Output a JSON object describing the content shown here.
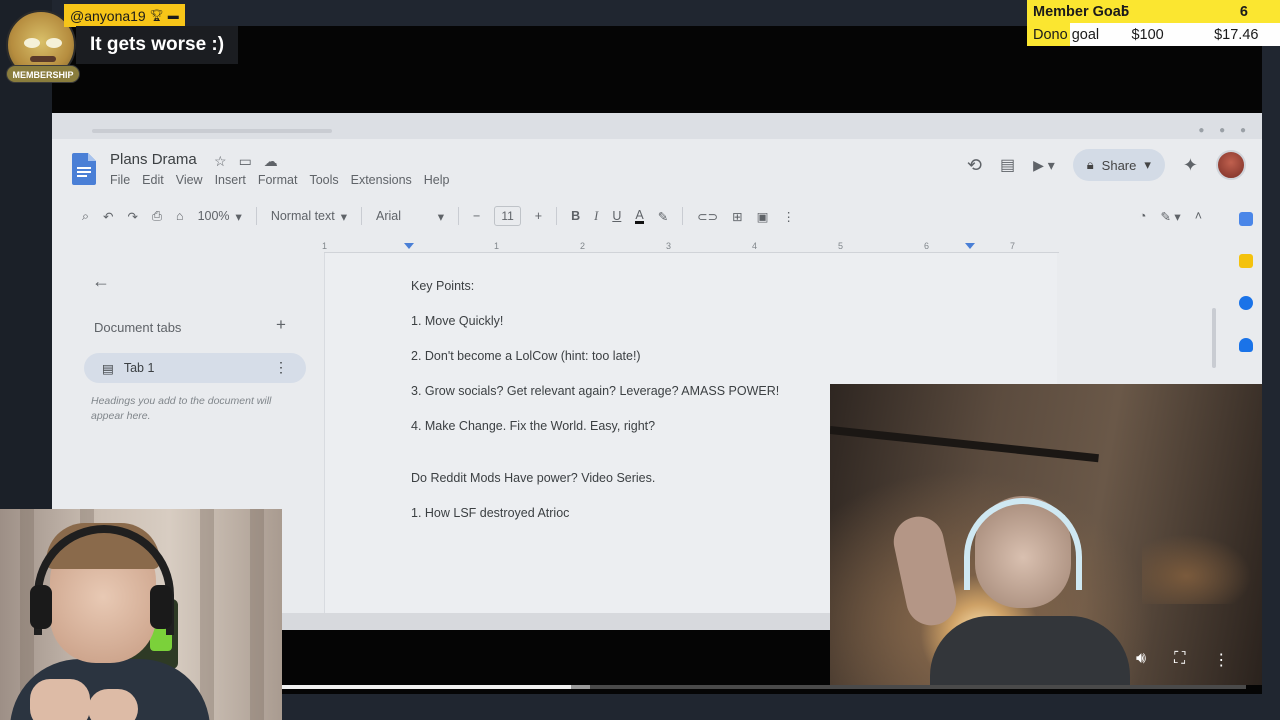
{
  "overlay": {
    "chat": {
      "username": "@anyona19",
      "message": "It gets worse :)",
      "member_tag": "MEMBERSHIP"
    },
    "goals": {
      "member": {
        "label": "Member Goal",
        "current": "6",
        "target": "5"
      },
      "dono": {
        "label": "Dono goal",
        "current": "$17.46",
        "target": "$100",
        "progress": 0.17
      }
    }
  },
  "doc": {
    "title": "Plans Drama",
    "menu": [
      "File",
      "Edit",
      "View",
      "Insert",
      "Format",
      "Tools",
      "Extensions",
      "Help"
    ],
    "toolbar": {
      "zoom": "100%",
      "style": "Normal text",
      "font": "Arial",
      "font_size": "11"
    },
    "share_label": "Share",
    "ruler_ticks": [
      "1",
      "1",
      "2",
      "3",
      "4",
      "5",
      "6",
      "7"
    ],
    "sidebar": {
      "tabs_label": "Document tabs",
      "active_tab": "Tab 1",
      "hint": "Headings you add to the document will appear here."
    },
    "lines": [
      "Key Points:",
      "1. Move Quickly!",
      "2.  Don't become a LolCow (hint: too late!)",
      "3. Grow socials?  Get relevant again?  Leverage? AMASS POWER!",
      "4. Make Change.  Fix the World. Easy, right?",
      "Do Reddit Mods Have power?  Video Series.",
      "1.  How LSF destroyed Atrioc"
    ]
  },
  "player": {
    "played_fraction": 0.3,
    "buffered_fraction": 0.32
  },
  "colors": {
    "accent_yellow": "#fbe630",
    "docs_blue": "#4a7fd6",
    "share_bg": "#d3dbe6"
  }
}
